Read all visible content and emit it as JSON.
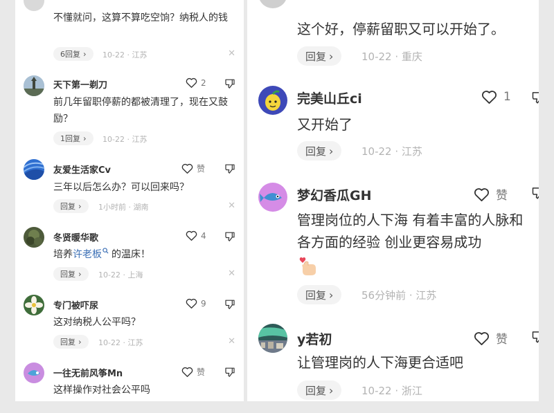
{
  "left": {
    "comments": [
      {
        "name": "",
        "text": "不懂就问，这算不算吃空饷？纳税人的钱",
        "reply": "6回复",
        "meta": "10-22 · 江苏",
        "likes": ""
      },
      {
        "name": "天下第一剃刀",
        "text": "前几年留职停薪的都被清理了，现在又鼓励？",
        "reply": "1回复",
        "meta": "10-22 · 江苏",
        "likes": "2"
      },
      {
        "name": "友爱生活家Cv",
        "text": "三年以后怎么办？可以回来吗？",
        "reply": "回复",
        "meta": "1小时前 · 湖南",
        "likes": "赞"
      },
      {
        "name": "冬贤暖华歌",
        "text_before": "培养",
        "text_link": "许老板",
        "text_after": "的温床！",
        "reply": "回复",
        "meta": "10-22 · 上海",
        "likes": "4"
      },
      {
        "name": "专门被吓尿",
        "text": "这对纳税人公平吗？",
        "reply": "回复",
        "meta": "10-22 · 江苏",
        "likes": "9"
      },
      {
        "name": "一往无前风筝Mn",
        "text": "这样操作对社会公平吗",
        "likes": "赞"
      }
    ]
  },
  "right": {
    "comments": [
      {
        "text": "这个好，停薪留职又可以开始了。",
        "reply": "回复",
        "meta": "10-22 · 重庆"
      },
      {
        "name": "完美山丘ci",
        "text": "又开始了",
        "reply": "回复",
        "meta": "10-22 · 江苏",
        "likes": "1"
      },
      {
        "name": "梦幻香瓜GH",
        "text": "管理岗位的人下海 有着丰富的人脉和各方面的经验 创业更容易成功",
        "reply": "回复",
        "meta": "56分钟前 · 江苏",
        "likes": "赞"
      },
      {
        "name": "y若初",
        "text": "让管理岗的人下海更合适吧",
        "reply": "回复",
        "meta": "10-22 · 浙江",
        "likes": "赞"
      }
    ]
  },
  "icons": {
    "heart": "heart-icon",
    "dislike": "thumbs-down-icon",
    "close": "close-icon",
    "chevron": "chevron-right-icon",
    "search": "search-icon",
    "hand_emoji": "finger-heart-emoji"
  }
}
